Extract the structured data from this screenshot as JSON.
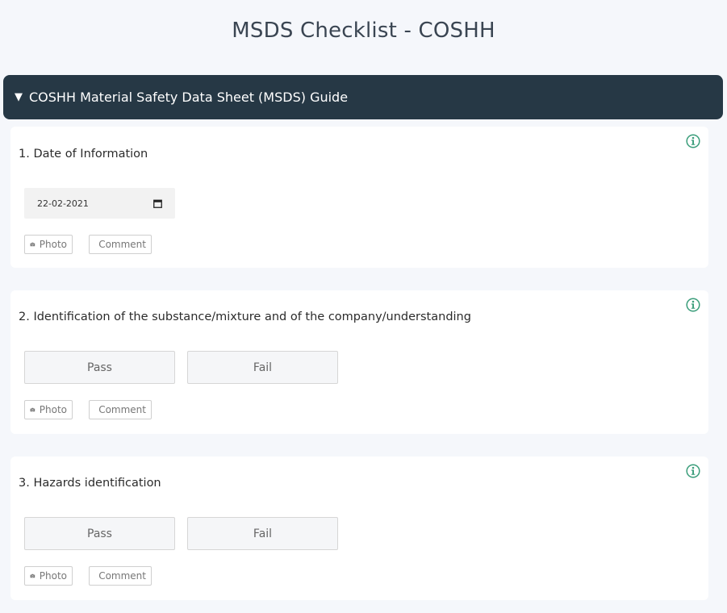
{
  "page": {
    "title": "MSDS Checklist - COSHH"
  },
  "section": {
    "caret": "▼",
    "title": "COSHH Material Safety Data Sheet (MSDS) Guide"
  },
  "colors": {
    "header_bg": "#263845",
    "info_icon": "#3a9d7a",
    "card_bg": "#ffffff",
    "page_bg": "#f5f7fb"
  },
  "questions": [
    {
      "label": "1. Date of Information",
      "type": "date",
      "value": "22-02-2021",
      "photo": "Photo",
      "comment": "Comment",
      "icon": "info-icon"
    },
    {
      "label": "2. Identification of the substance/mixture and of the company/understanding",
      "type": "pass-fail",
      "pass": "Pass",
      "fail": "Fail",
      "photo": "Photo",
      "comment": "Comment",
      "icon": "info-icon"
    },
    {
      "label": "3. Hazards identification",
      "type": "pass-fail",
      "pass": "Pass",
      "fail": "Fail",
      "photo": "Photo",
      "comment": "Comment",
      "icon": "info-icon"
    }
  ]
}
